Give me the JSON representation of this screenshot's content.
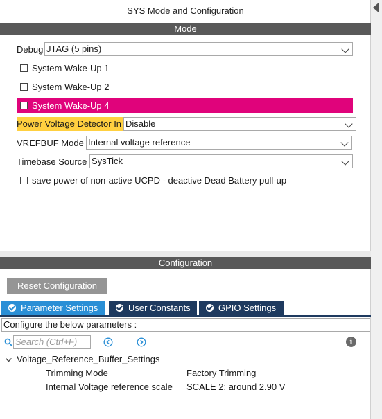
{
  "window": {
    "title": "SYS Mode and Configuration"
  },
  "mode": {
    "section_label": "Mode",
    "debug": {
      "label": "Debug",
      "value": "JTAG (5 pins)"
    },
    "wakeups": [
      {
        "label": "System Wake-Up 1",
        "checked": false
      },
      {
        "label": "System Wake-Up 2",
        "checked": false
      },
      {
        "label": "System Wake-Up 4",
        "checked": false,
        "highlight": "#e0037b"
      }
    ],
    "pvd": {
      "label": "Power Voltage Detector In",
      "value": "Disable"
    },
    "vrefbuf": {
      "label": "VREFBUF Mode",
      "value": "Internal voltage reference"
    },
    "timebase": {
      "label": "Timebase Source",
      "value": "SysTick"
    },
    "ucpd": {
      "label": "save power of non-active UCPD - deactive Dead Battery pull-up",
      "checked": false
    }
  },
  "configuration": {
    "section_label": "Configuration",
    "reset_label": "Reset Configuration",
    "tabs": [
      {
        "label": "Parameter Settings",
        "active": true
      },
      {
        "label": "User Constants",
        "active": false
      },
      {
        "label": "GPIO Settings",
        "active": false
      }
    ],
    "instructions": "Configure the below parameters :",
    "search_placeholder": "Search (Ctrl+F)",
    "group": {
      "label": "Voltage_Reference_Buffer_Settings",
      "params": [
        {
          "name": "Trimming Mode",
          "value": "Factory Trimming"
        },
        {
          "name": "Internal Voltage reference scale",
          "value": "SCALE 2: around 2.90 V"
        }
      ]
    }
  }
}
